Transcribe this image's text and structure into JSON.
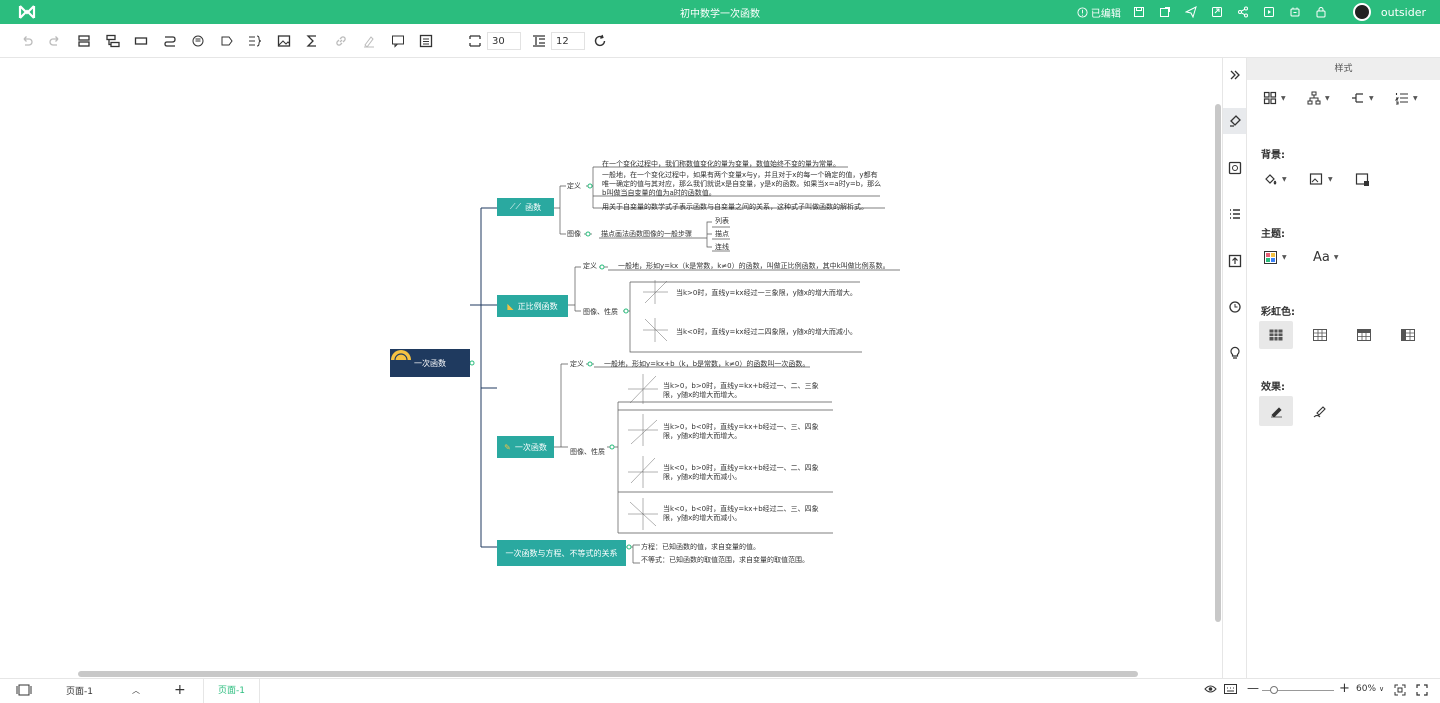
{
  "topbar": {
    "title": "初中数学一次函数",
    "status": "已编辑",
    "username": "outsider"
  },
  "toolbar": {
    "spacing_value": "30",
    "line_spacing_value": "12"
  },
  "map": {
    "root": "一次函数",
    "b1": {
      "label": "函数",
      "def_tag": "定义",
      "def1": "在一个变化过程中，我们称数值变化的量为变量，数值始终不变的量为常量。",
      "def2": "一般地，在一个变化过程中，如果有两个变量x与y，并且对于x的每一个确定的值，y都有唯一确定的值与其对应，那么我们就说x是自变量，y是x的函数。如果当x=a时y=b，那么b叫做当自变量的值为a时的函数值。",
      "def3": "用关于自变量的数学式子表示函数与自变量之间的关系，这种式子叫做函数的解析式。",
      "img_tag": "图像",
      "img_text": "描点画法函数图像的一般步骤",
      "steps": [
        "列表",
        "描点",
        "连线"
      ]
    },
    "b2": {
      "label": "正比例函数",
      "def_tag": "定义",
      "def": "一般地，形如y=kx（k是常数，k≠0）的函数，叫做正比例函数，其中k叫做比例系数。",
      "prop_tag": "图像、性质",
      "p1": "当k>0时，直线y=kx经过一三象限，y随x的增大而增大。",
      "p2": "当k<0时，直线y=kx经过二四象限，y随x的增大而减小。"
    },
    "b3": {
      "label": "一次函数",
      "def_tag": "定义",
      "def": "一般地，形如y=kx+b（k，b是常数，k≠0）的函数叫一次函数。",
      "prop_tag": "图像、性质",
      "p1": "当k>0，b>0时，直线y=kx+b经过一、二、三象限，y随x的增大而增大。",
      "p2": "当k>0，b<0时，直线y=kx+b经过一、三、四象限，y随x的增大而增大。",
      "p3": "当k<0，b>0时，直线y=kx+b经过一、二、四象限，y随x的增大而减小。",
      "p4": "当k<0，b<0时，直线y=kx+b经过二、三、四象限，y随x的增大而减小。"
    },
    "b4": {
      "label": "一次函数与方程、不等式的关系",
      "l1": "方程：已知函数的值，求自变量的值。",
      "l2": "不等式：已知函数的取值范围，求自变量的取值范围。"
    }
  },
  "panel": {
    "title": "样式",
    "background_label": "背景:",
    "theme_label": "主题:",
    "rainbow_label": "彩虹色:",
    "effect_label": "效果:"
  },
  "footer": {
    "page_select": "页面-1",
    "page_tab": "页面-1",
    "zoom": "60%"
  }
}
